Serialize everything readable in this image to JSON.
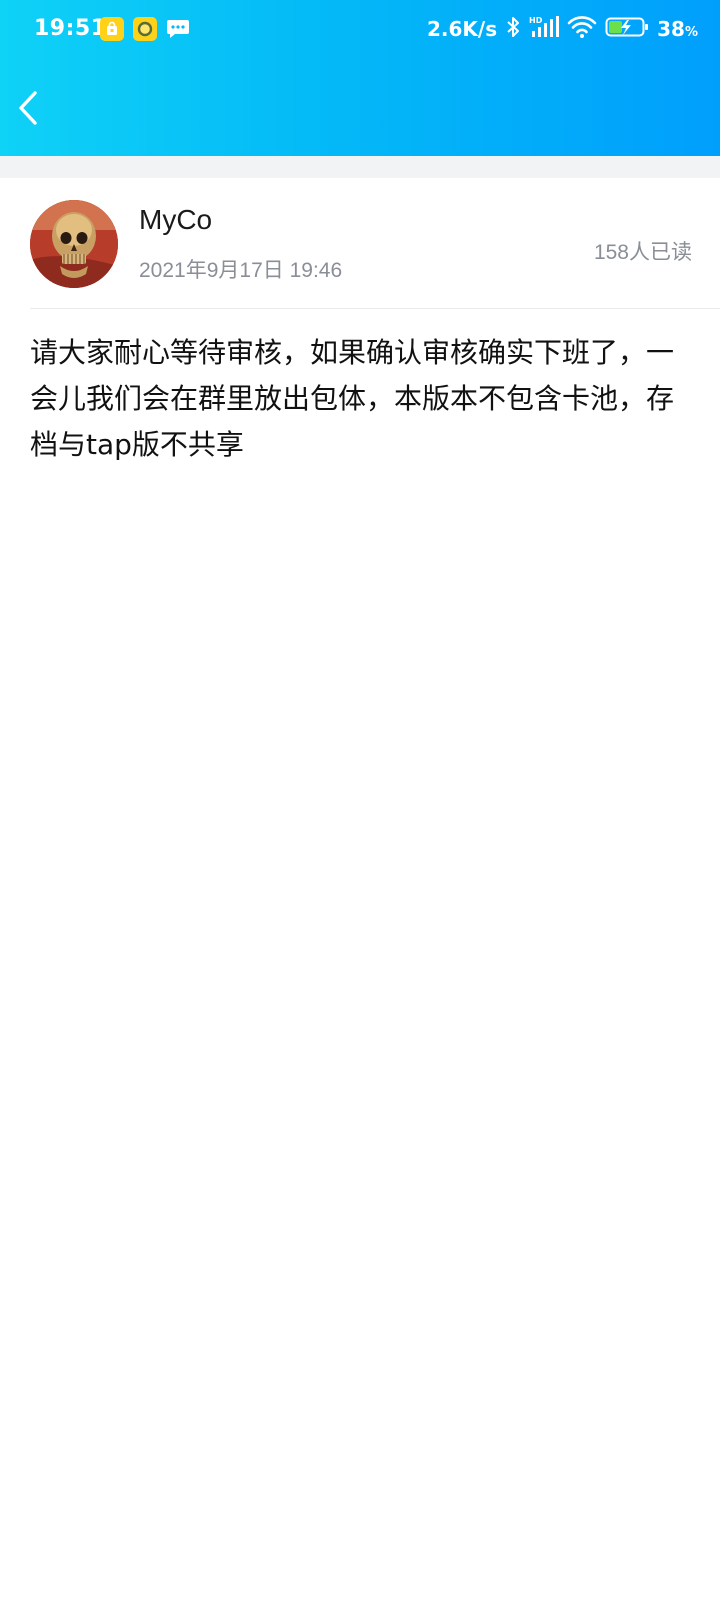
{
  "status_bar": {
    "time": "19:51",
    "network_speed": "2.6K/s",
    "battery_percent": "38",
    "battery_unit": "%",
    "icons": [
      "bag-notification-icon",
      "circle-app-notification-icon",
      "message-notification-icon",
      "bluetooth-icon",
      "hd-signal-icon",
      "wifi-icon",
      "battery-charging-icon"
    ]
  },
  "nav": {
    "back_icon": "chevron-left-icon"
  },
  "post": {
    "author": "MyCo",
    "date": "2021年9月17日 19:46",
    "read_count": "158人已读",
    "body": "请大家耐心等待审核，如果确认审核确实下班了，一会儿我们会在群里放出包体，本版本不包含卡池，存档与tap版不共享"
  },
  "colors": {
    "header_gradient_start": "#0fd2f7",
    "header_gradient_end": "#009ffc",
    "secondary_text": "#8a8e96",
    "notification_yellow": "#ffd21a"
  }
}
